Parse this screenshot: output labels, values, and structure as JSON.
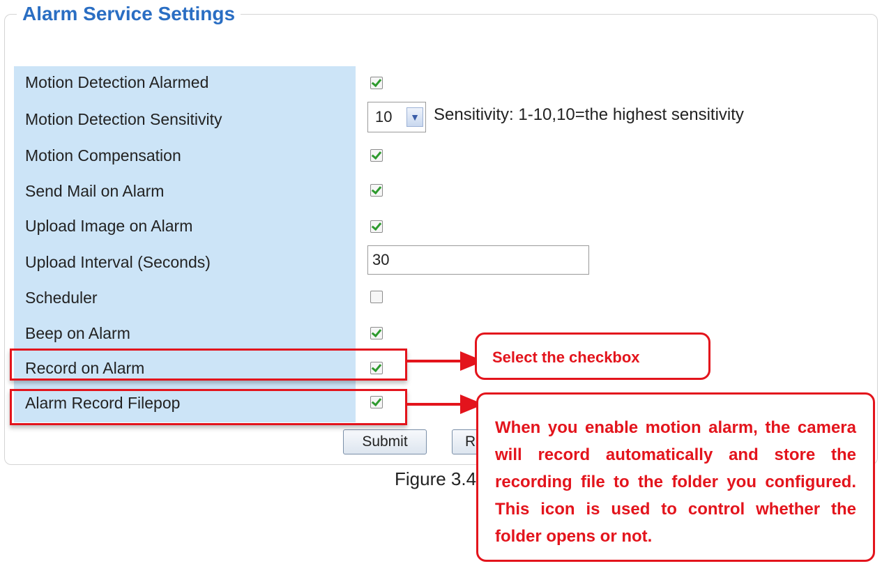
{
  "panel": {
    "title": "Alarm Service Settings"
  },
  "rows": [
    {
      "label": "Motion Detection Alarmed",
      "checked": true
    },
    {
      "label": "Motion Detection Sensitivity"
    },
    {
      "label": "Motion Compensation",
      "checked": true
    },
    {
      "label": "Send Mail on Alarm",
      "checked": true
    },
    {
      "label": "Upload Image on Alarm",
      "checked": true
    },
    {
      "label": "Upload Interval (Seconds)"
    },
    {
      "label": "Scheduler",
      "checked": false
    },
    {
      "label": "Beep on Alarm",
      "checked": true
    },
    {
      "label": "Record on Alarm",
      "checked": true
    },
    {
      "label": "Alarm Record Filepop",
      "checked": true
    }
  ],
  "sensitivity": {
    "value": "10",
    "hint": "Sensitivity: 1-10,10=the highest sensitivity"
  },
  "upload_interval": {
    "value": "30"
  },
  "buttons": {
    "submit": "Submit",
    "refresh_partial": "R"
  },
  "callouts": {
    "select": "Select the checkbox",
    "explain": "When you enable motion alarm, the camera will record automatically and store the recording file to the folder you configured. This icon is used to control whether the folder opens or not."
  },
  "caption": "Figure 3.4",
  "colors": {
    "accent": "#2a6ec3",
    "annotation": "#e3141c",
    "label_bg": "#cce4f7"
  }
}
